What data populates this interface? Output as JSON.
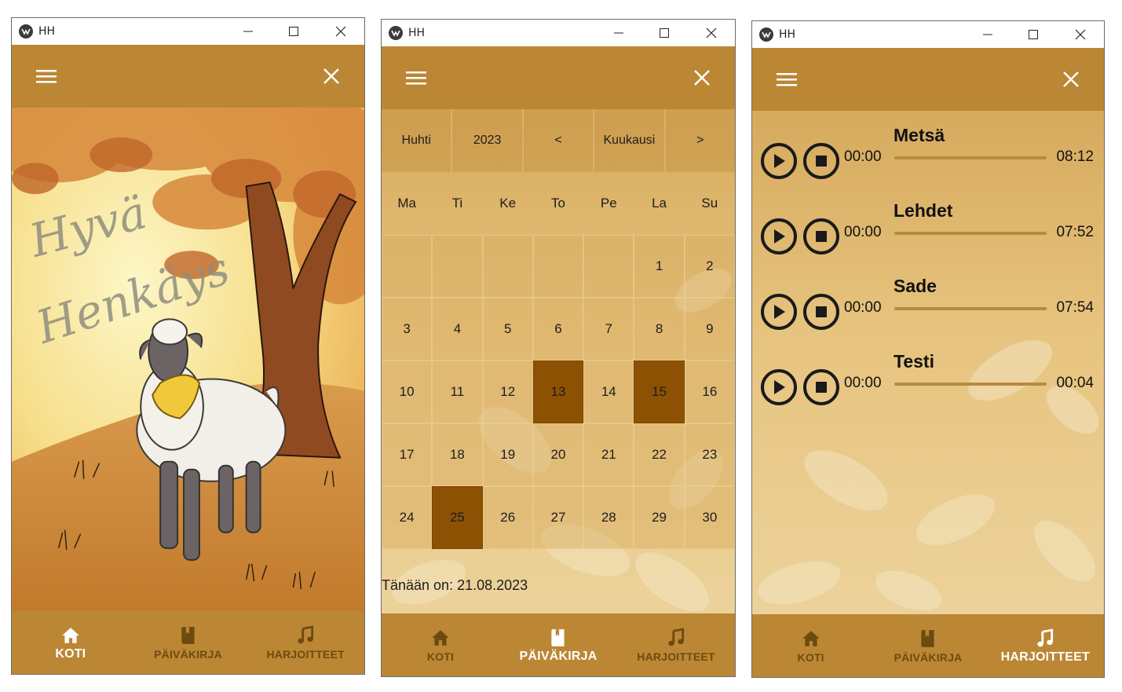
{
  "window": {
    "title": "HH"
  },
  "nav": {
    "home": "KOTI",
    "diary": "PÄIVÄKIRJA",
    "exercises": "HARJOITTEET"
  },
  "icons": {
    "menu": "hamburger-icon",
    "close": "close-icon",
    "home": "home-icon",
    "diary": "book-icon",
    "exercises": "music-note-icon",
    "play": "play-icon",
    "stop": "stop-icon"
  },
  "colors": {
    "bar": "#bb8734",
    "marked_day": "#8d5104",
    "active_nav": "#ffffff",
    "inactive_nav": "#6d4a10"
  },
  "home": {
    "art_title_line1": "Hyvä",
    "art_title_line2": "Henkäys"
  },
  "calendar": {
    "header": {
      "month": "Huhti",
      "year": "2023",
      "prev": "<",
      "mode": "Kuukausi",
      "next": ">"
    },
    "weekdays": [
      "Ma",
      "Ti",
      "Ke",
      "To",
      "Pe",
      "La",
      "Su"
    ],
    "days": [
      "",
      "",
      "",
      "",
      "",
      "1",
      "2",
      "3",
      "4",
      "5",
      "6",
      "7",
      "8",
      "9",
      "10",
      "11",
      "12",
      "13",
      "14",
      "15",
      "16",
      "17",
      "18",
      "19",
      "20",
      "21",
      "22",
      "23",
      "24",
      "25",
      "26",
      "27",
      "28",
      "29",
      "30"
    ],
    "marked": [
      "13",
      "15",
      "25"
    ],
    "today_text": "Tänään on: 21.08.2023"
  },
  "exercises": {
    "tracks": [
      {
        "title": "Metsä",
        "position": "00:00",
        "duration": "08:12",
        "progress": 0
      },
      {
        "title": "Lehdet",
        "position": "00:00",
        "duration": "07:52",
        "progress": 0
      },
      {
        "title": "Sade",
        "position": "00:00",
        "duration": "07:54",
        "progress": 0
      },
      {
        "title": "Testi",
        "position": "00:00",
        "duration": "00:04",
        "progress": 0
      }
    ]
  }
}
